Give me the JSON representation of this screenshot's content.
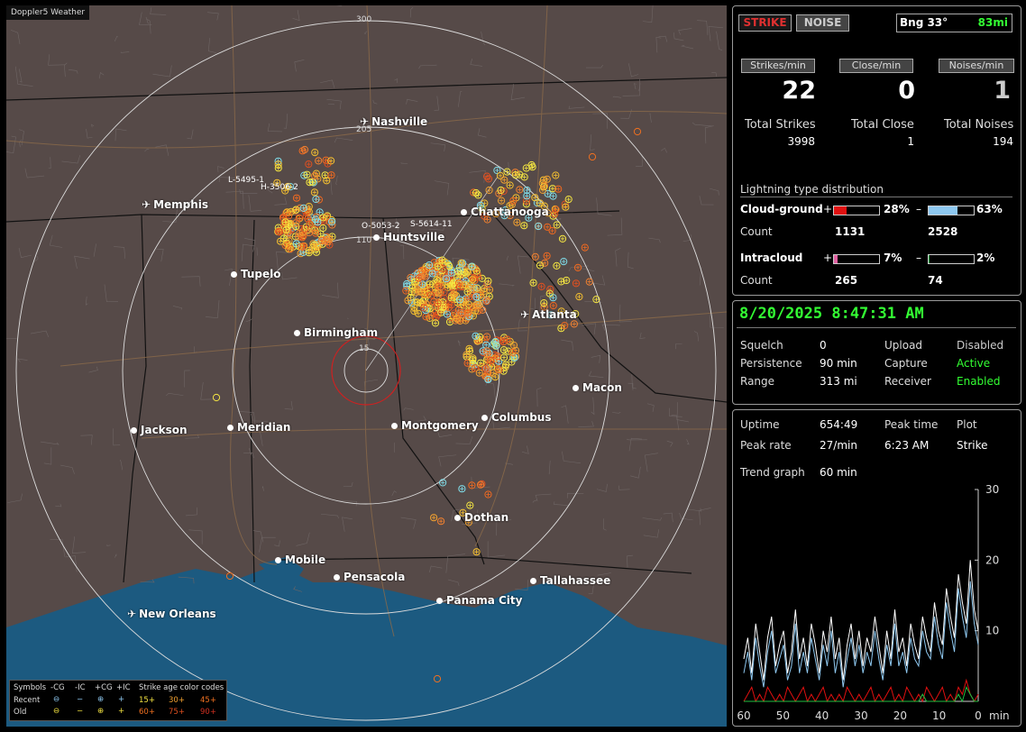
{
  "map": {
    "watermark": "Doppler5 Weather",
    "range_labels": [
      "300",
      "205",
      "110",
      "15"
    ],
    "cities": [
      {
        "name": "Nashville",
        "icon": "plane"
      },
      {
        "name": "Memphis",
        "icon": "plane"
      },
      {
        "name": "Chattanooga",
        "icon": "dot"
      },
      {
        "name": "Huntsville",
        "icon": "dot"
      },
      {
        "name": "Tupelo",
        "icon": "dot"
      },
      {
        "name": "Atlanta",
        "icon": "plane"
      },
      {
        "name": "Birmingham",
        "icon": "dot"
      },
      {
        "name": "Macon",
        "icon": "dot"
      },
      {
        "name": "Jackson",
        "icon": "dot"
      },
      {
        "name": "Meridian",
        "icon": "dot"
      },
      {
        "name": "Montgomery",
        "icon": "dot"
      },
      {
        "name": "Columbus",
        "icon": "dot"
      },
      {
        "name": "Dothan",
        "icon": "dot"
      },
      {
        "name": "Mobile",
        "icon": "dot"
      },
      {
        "name": "Pensacola",
        "icon": "dot"
      },
      {
        "name": "Tallahassee",
        "icon": "dot"
      },
      {
        "name": "Panama City",
        "icon": "dot"
      },
      {
        "name": "New Orleans",
        "icon": "plane"
      }
    ],
    "storm_labels": [
      "L-5495-1",
      "H-3506-2",
      "O-5053-2",
      "S-5614-11"
    ],
    "legend": {
      "symbols_label": "Symbols",
      "headers": [
        "-CG",
        "-IC",
        "+CG",
        "+IC"
      ],
      "age_title": "Strike age color codes",
      "rows": [
        {
          "label": "Recent",
          "ages": [
            "15+",
            "30+",
            "45+"
          ]
        },
        {
          "label": "Old",
          "ages": [
            "60+",
            "75+",
            "90+"
          ]
        }
      ]
    }
  },
  "status": {
    "strike_label": "STRIKE",
    "noise_label": "NOISE",
    "bearing": "Bng 33°",
    "distance": "83mi",
    "strikes_per_min_label": "Strikes/min",
    "close_per_min_label": "Close/min",
    "noises_per_min_label": "Noises/min",
    "strikes_per_min": "22",
    "close_per_min": "0",
    "noises_per_min": "1",
    "total_strikes_label": "Total Strikes",
    "total_close_label": "Total Close",
    "total_noises_label": "Total Noises",
    "total_strikes": "3998",
    "total_close": "1",
    "total_noises": "194"
  },
  "distribution": {
    "title": "Lightning type distribution",
    "cg_label": "Cloud-ground",
    "ic_label": "Intracloud",
    "count_label": "Count",
    "plus_sign": "+",
    "minus_sign": "–",
    "cg_pos_pct": "28%",
    "cg_neg_pct": "63%",
    "cg_pos_count": "1131",
    "cg_neg_count": "2528",
    "ic_pos_pct": "7%",
    "ic_neg_pct": "2%",
    "ic_pos_count": "265",
    "ic_neg_count": "74",
    "fills": {
      "cg_pos": 0.28,
      "cg_neg": 0.63,
      "ic_pos": 0.07,
      "ic_neg": 0.02
    },
    "colors": {
      "cg_pos": "#e01010",
      "cg_neg": "#8ec8f0",
      "ic_pos": "#e060a0",
      "ic_neg": "#20a040"
    }
  },
  "settings": {
    "datetime": "8/20/2025 8:47:31 AM",
    "squelch_label": "Squelch",
    "squelch": "0",
    "persistence_label": "Persistence",
    "persistence": "90 min",
    "range_label": "Range",
    "range": "313 mi",
    "upload_label": "Upload",
    "upload": "Disabled",
    "capture_label": "Capture",
    "capture": "Active",
    "receiver_label": "Receiver",
    "receiver": "Enabled"
  },
  "stats": {
    "uptime_label": "Uptime",
    "uptime": "654:49",
    "peak_time_label": "Peak time",
    "peak_time": "6:23 AM",
    "plot_label": "Plot",
    "plot": "Strike",
    "peak_rate_label": "Peak rate",
    "peak_rate": "27/min",
    "trend_label": "Trend graph",
    "trend": "60 min"
  },
  "chart_data": {
    "type": "line",
    "xlabel": "min",
    "x_ticks": [
      "60",
      "50",
      "40",
      "30",
      "20",
      "10",
      "0"
    ],
    "y_ticks": [
      "30",
      "20",
      "10"
    ],
    "xlim": [
      60,
      0
    ],
    "ylim": [
      0,
      30
    ],
    "series": [
      {
        "color": "#ffffff",
        "values": [
          6,
          9,
          4,
          11,
          7,
          3,
          9,
          12,
          5,
          8,
          10,
          4,
          7,
          13,
          6,
          9,
          5,
          11,
          8,
          4,
          10,
          7,
          12,
          6,
          9,
          3,
          8,
          11,
          6,
          10,
          5,
          9,
          7,
          12,
          8,
          4,
          10,
          6,
          13,
          7,
          9,
          5,
          11,
          8,
          6,
          12,
          9,
          7,
          14,
          10,
          8,
          16,
          12,
          9,
          18,
          14,
          11,
          20,
          13,
          10
        ]
      },
      {
        "color": "#8ec8f0",
        "values": [
          4,
          7,
          3,
          9,
          5,
          2,
          7,
          10,
          4,
          6,
          8,
          3,
          5,
          11,
          4,
          7,
          4,
          9,
          6,
          3,
          8,
          5,
          10,
          4,
          7,
          2,
          6,
          9,
          5,
          8,
          4,
          7,
          5,
          10,
          6,
          3,
          8,
          5,
          11,
          5,
          7,
          4,
          9,
          6,
          5,
          10,
          7,
          6,
          12,
          8,
          6,
          14,
          10,
          7,
          16,
          12,
          9,
          17,
          11,
          8
        ]
      },
      {
        "color": "#e01010",
        "values": [
          0,
          1,
          2,
          0,
          1,
          0,
          2,
          1,
          0,
          1,
          0,
          2,
          1,
          0,
          1,
          2,
          0,
          1,
          0,
          1,
          2,
          0,
          1,
          0,
          1,
          0,
          2,
          1,
          0,
          1,
          0,
          1,
          2,
          0,
          1,
          0,
          1,
          2,
          0,
          1,
          0,
          2,
          1,
          0,
          1,
          0,
          2,
          1,
          0,
          1,
          2,
          0,
          1,
          0,
          2,
          1,
          3,
          1,
          0,
          1
        ]
      },
      {
        "color": "#20c040",
        "values": [
          0,
          0,
          0,
          0,
          0,
          0,
          0,
          0,
          0,
          0,
          0,
          0,
          0,
          0,
          0,
          0,
          0,
          0,
          0,
          0,
          0,
          0,
          0,
          0,
          0,
          0,
          0,
          0,
          0,
          0,
          0,
          0,
          0,
          0,
          0,
          0,
          0,
          0,
          0,
          0,
          0,
          0,
          0,
          0,
          0,
          1,
          0,
          0,
          0,
          0,
          0,
          0,
          0,
          0,
          1,
          0,
          2,
          1,
          0,
          0
        ]
      }
    ]
  }
}
